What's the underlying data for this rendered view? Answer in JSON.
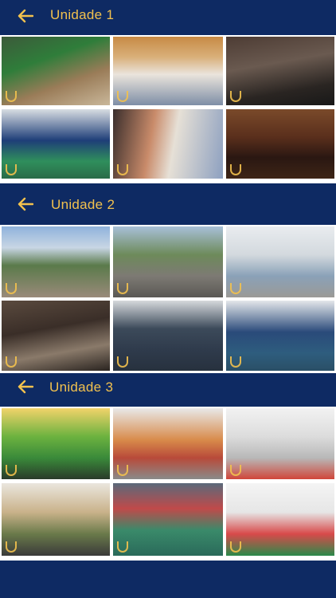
{
  "sections": [
    {
      "title": "Unidade 1",
      "photos": [
        {
          "label": "playground-photo",
          "bg": "linear-gradient(160deg,#3c5a3a 0%,#2f7d3a 35%,#9a7c58 65%,#c9b79a 100%)"
        },
        {
          "label": "cafeteria-photo",
          "bg": "linear-gradient(180deg,#c78a45 0%,#d9b07a 30%,#eae4dc 55%,#7e8ea6 100%)"
        },
        {
          "label": "tech-classroom-photo",
          "bg": "linear-gradient(170deg,#4d3c34 0%,#6a5a50 40%,#2a2522 75%,#181818 100%)"
        },
        {
          "label": "sports-court-photo",
          "bg": "linear-gradient(180deg,#d8dde2 0%,#1e3e78 45%,#2f8f5c 75%,#2a6b48 100%)"
        },
        {
          "label": "hallway-photo",
          "bg": "linear-gradient(100deg,#3a2e2c 0%,#c98b6a 35%,#e6e0d6 55%,#8da0c0 100%)"
        },
        {
          "label": "auditorium-photo",
          "bg": "linear-gradient(180deg,#7a4a2a 0%,#5a2f1c 40%,#2a1712 70%,#3e2516 100%)"
        }
      ]
    },
    {
      "title": "Unidade 2",
      "photos": [
        {
          "label": "courtyard-photo",
          "bg": "linear-gradient(180deg,#8fb2dc 0%,#c8d6e4 30%,#5a7a4a 55%,#9a8a7a 100%)"
        },
        {
          "label": "patio-tables-photo",
          "bg": "linear-gradient(180deg,#a8c0d8 0%,#6d8a5a 40%,#7d7a74 70%,#5a5854 100%)"
        },
        {
          "label": "open-hall-photo",
          "bg": "linear-gradient(180deg,#e9ecef 0%,#d3d9de 40%,#8aa1b8 70%,#9b9a96 100%)"
        },
        {
          "label": "library-photo",
          "bg": "linear-gradient(170deg,#5a4a3e 0%,#3a2e28 40%,#8a7a6a 70%,#2a2420 100%)"
        },
        {
          "label": "gym-photo",
          "bg": "linear-gradient(180deg,#d6d9dc 0%,#3c4a5a 40%,#2f3b4c 70%,#27313e 100%)"
        },
        {
          "label": "indoor-court-photo",
          "bg": "linear-gradient(180deg,#e4e7ea 0%,#2a4a7a 45%,#2e5d7e 75%,#2a4f66 100%)"
        }
      ]
    },
    {
      "title": "Unidade 3",
      "photos": [
        {
          "label": "kids-playroom-photo",
          "bg": "linear-gradient(180deg,#f1d36a 0%,#6cb23f 40%,#3a8a3a 70%,#2a3a2a 100%)"
        },
        {
          "label": "game-room-photo",
          "bg": "linear-gradient(180deg,#e8e8e8 0%,#d88a4a 45%,#b84a3a 70%,#8a8a8a 100%)"
        },
        {
          "label": "science-lab-photo",
          "bg": "linear-gradient(180deg,#f2f2f2 0%,#dcdcdc 40%,#b8b8b8 70%,#d0463a 100%)"
        },
        {
          "label": "building-exterior-photo",
          "bg": "linear-gradient(180deg,#eae6de 0%,#c9b28a 40%,#6a7a4a 70%,#3a3a3a 100%)"
        },
        {
          "label": "covered-court-photo",
          "bg": "linear-gradient(180deg,#5a6a7a 0%,#c04a4a 35%,#3a8a6a 65%,#2a6a5a 100%)"
        },
        {
          "label": "classroom-photo",
          "bg": "linear-gradient(180deg,#f4f4f4 0%,#e6e6e6 40%,#d84a4a 70%,#2a8a4a 100%)"
        }
      ]
    }
  ]
}
